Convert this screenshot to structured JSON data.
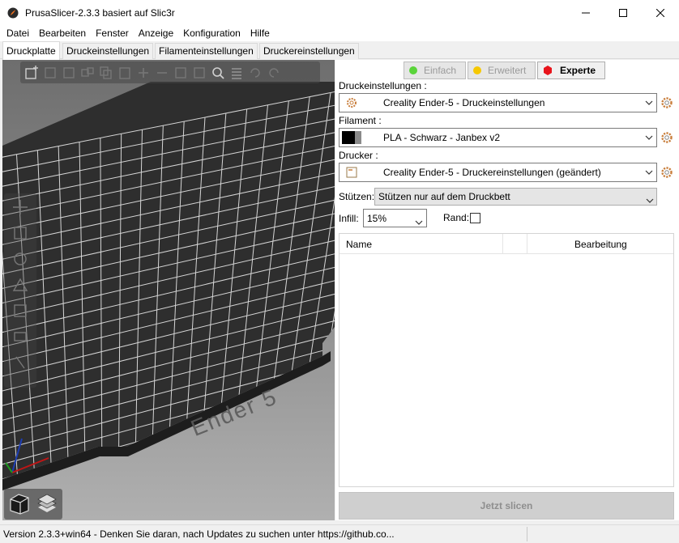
{
  "window": {
    "title": "PrusaSlicer-2.3.3 basiert auf Slic3r"
  },
  "menu": [
    "Datei",
    "Bearbeiten",
    "Fenster",
    "Anzeige",
    "Konfiguration",
    "Hilfe"
  ],
  "tabs": [
    "Druckplatte",
    "Druckeinstellungen",
    "Filamenteinstellungen",
    "Druckereinstellungen"
  ],
  "active_tab": "Druckplatte",
  "viewport": {
    "bed_label": "Ender 5"
  },
  "modes": {
    "simple": "Einfach",
    "advanced": "Erweitert",
    "expert": "Experte",
    "colors": {
      "simple": "#5ad43a",
      "advanced": "#f6c800",
      "expert": "#e8141b"
    }
  },
  "print_settings": {
    "label": "Druckeinstellungen :",
    "value": "Creality Ender-5 - Druckeinstellungen"
  },
  "filament": {
    "label": "Filament :",
    "value": "PLA - Schwarz - Janbex v2"
  },
  "printer": {
    "label": "Drucker :",
    "value": "Creality Ender-5 - Druckereinstellungen (geändert)"
  },
  "supports": {
    "label": "Stützen:",
    "value": "Stützen nur auf dem Druckbett"
  },
  "infill": {
    "label": "Infill:",
    "value": "15%"
  },
  "brim": {
    "label": "Rand:",
    "checked": false
  },
  "object_list": {
    "col_name": "Name",
    "col_edit": "Bearbeitung"
  },
  "slice_button": "Jetzt slicen",
  "status": "Version 2.3.3+win64 - Denken Sie daran, nach Updates zu suchen unter https://github.co..."
}
